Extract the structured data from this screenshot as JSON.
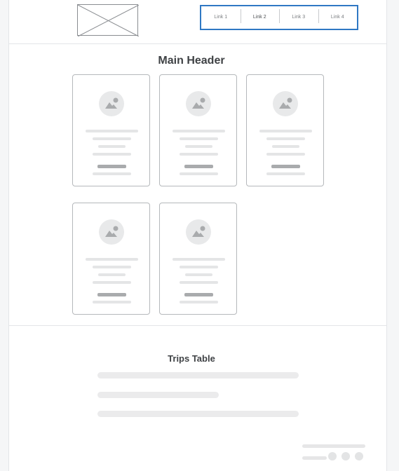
{
  "nav": {
    "links": [
      {
        "label": "Link 1"
      },
      {
        "label": "Link 2"
      },
      {
        "label": "Link 3"
      },
      {
        "label": "Link 4"
      }
    ],
    "active_index": 1
  },
  "main": {
    "header": "Main Header",
    "card_count": 5,
    "card_icon": "image-placeholder-icon"
  },
  "trips": {
    "title": "Trips Table"
  },
  "colors": {
    "nav_border": "#2f78c4",
    "placeholder": "#e4e5e6",
    "placeholder_dark": "#a9abad"
  }
}
